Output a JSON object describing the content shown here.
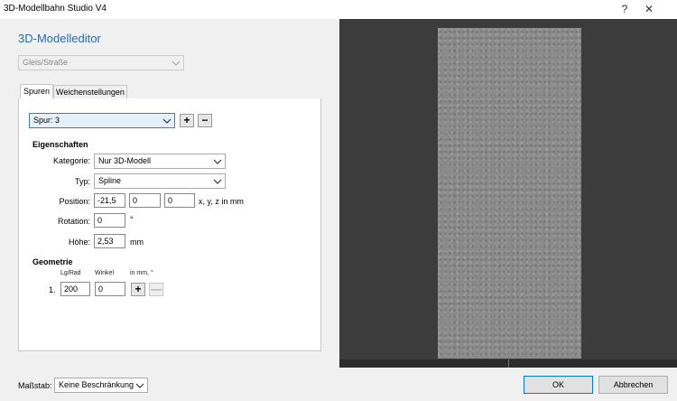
{
  "window": {
    "title": "3D-Modellbahn Studio V4",
    "help": "?",
    "close": "✕"
  },
  "editor": {
    "title": "3D-Modelleditor",
    "type_select": "Gleis/Straße"
  },
  "tabs": [
    {
      "label": "Spuren"
    },
    {
      "label": "Weichenstellungen"
    }
  ],
  "spur": {
    "selected": "Spur: 3",
    "add": "+",
    "remove": "−"
  },
  "eigenschaften": {
    "heading": "Eigenschaften",
    "kategorie": {
      "label": "Kategorie:",
      "value": "Nur 3D-Modell"
    },
    "typ": {
      "label": "Typ:",
      "value": "Spline"
    },
    "position": {
      "label": "Position:",
      "x": "-21,5",
      "y": "0",
      "z": "0",
      "unit": "x, y, z in mm"
    },
    "rotation": {
      "label": "Rotation:",
      "value": "0",
      "unit": "°"
    },
    "hoehe": {
      "label": "Höhe:",
      "value": "2,53",
      "unit": "mm"
    }
  },
  "geometrie": {
    "heading": "Geometrie",
    "col_lgrad": "Lg/Rad",
    "col_winkel": "Winkel",
    "col_unit": "in mm, °",
    "rows": [
      {
        "index": "1.",
        "lgrad": "200",
        "winkel": "0",
        "add": "+",
        "remove": "—"
      }
    ]
  },
  "footer": {
    "massstab_label": "Maßstab:",
    "massstab_value": "Keine Beschränkung",
    "ok": "OK",
    "cancel": "Abbrechen"
  }
}
